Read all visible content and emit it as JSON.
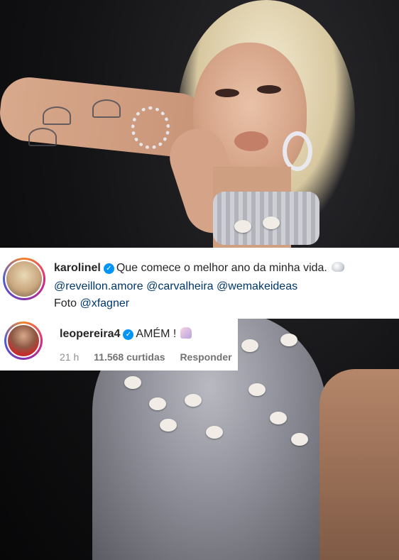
{
  "post": {
    "author": "karolinel",
    "caption": "Que comece o melhor ano da minha vida.",
    "caption_emoji_icon": "shell-icon",
    "mentions": [
      "@reveillon.amore",
      "@carvalheira",
      "@wemakeideas"
    ],
    "photo_credit_label": "Foto",
    "photo_credit_mention": "@xfagner"
  },
  "comment": {
    "author": "leopereira4",
    "text": "AMÉM !",
    "emoji_icon": "praying-hands-icon",
    "time": "21 h",
    "likes": "11.568 curtidas",
    "reply_label": "Responder"
  },
  "colors": {
    "verified": "#0095f6",
    "mention": "#00376b",
    "text": "#262626",
    "meta": "#8e8e8e"
  }
}
